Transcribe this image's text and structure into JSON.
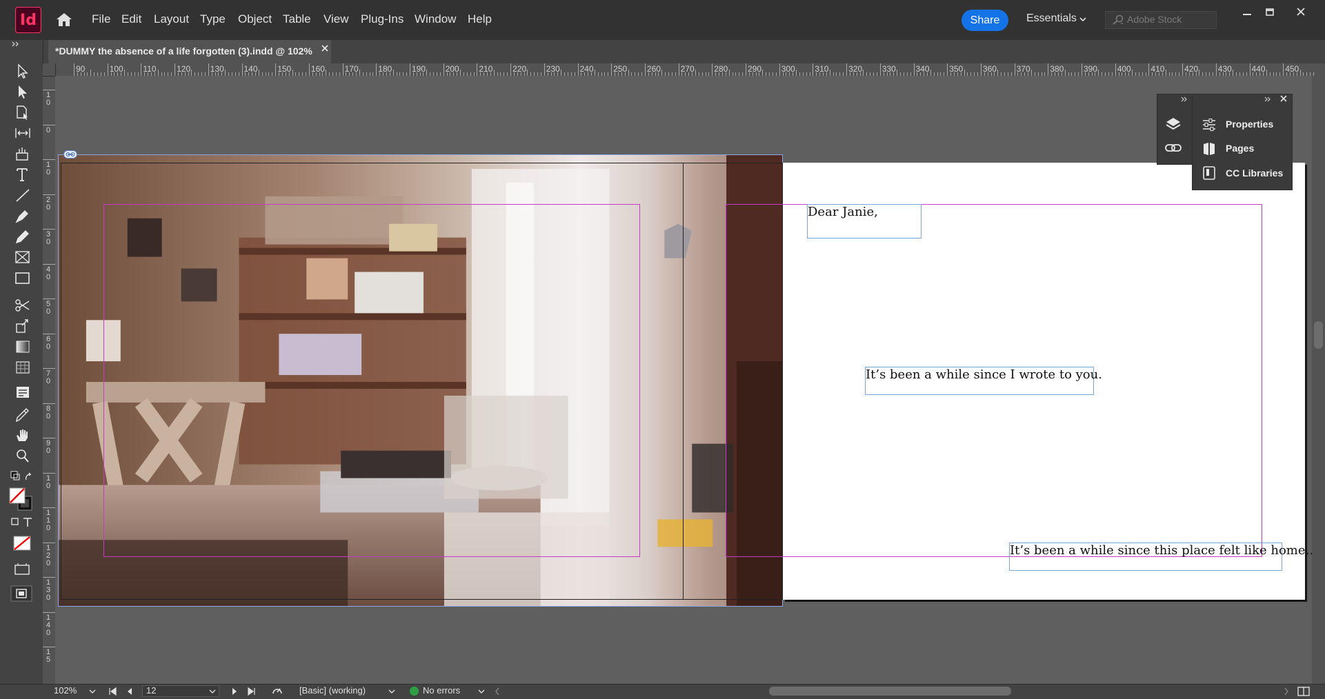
{
  "app": {
    "logo_text": "Id",
    "menu": [
      "File",
      "Edit",
      "Layout",
      "Type",
      "Object",
      "Table",
      "View",
      "Plug-Ins",
      "Window",
      "Help"
    ],
    "share_label": "Share",
    "workspace_label": "Essentials",
    "stock_search_placeholder": "Adobe Stock"
  },
  "document": {
    "tab_title": "*DUMMY the absence of a life forgotten (3).indd @ 102%"
  },
  "ruler": {
    "horizontal": [
      "90",
      "100",
      "110",
      "120",
      "130",
      "140",
      "150",
      "160",
      "170",
      "180",
      "190",
      "200",
      "210",
      "220",
      "230",
      "240",
      "250",
      "260",
      "270",
      "280",
      "290",
      "300",
      "310",
      "320",
      "330",
      "340",
      "350",
      "360",
      "370",
      "380",
      "390",
      "400",
      "410",
      "420",
      "430",
      "440",
      "450"
    ],
    "vertical": [
      "1\n0",
      "0",
      "1\n0",
      "2\n0",
      "3\n0",
      "4\n0",
      "5\n0",
      "6\n0",
      "7\n0",
      "8\n0",
      "9\n0",
      "1\n0",
      "1\n1\n0",
      "1\n2\n0",
      "1\n3\n0",
      "1\n4\n0",
      "1\n5"
    ]
  },
  "page": {
    "text_frames": [
      {
        "text": "Dear Janie,"
      },
      {
        "text": "It’s been a while since I wrote to you."
      },
      {
        "text": "It’s been a while since this place felt like home…"
      }
    ]
  },
  "panels": {
    "items": [
      {
        "label": "Properties",
        "icon": "sliders-icon"
      },
      {
        "label": "Pages",
        "icon": "pages-icon"
      },
      {
        "label": "CC Libraries",
        "icon": "libraries-icon"
      }
    ],
    "side_icons": [
      "layers-icon",
      "links-icon"
    ]
  },
  "status": {
    "zoom": "102%",
    "page_number": "12",
    "preflight_profile": "[Basic] (working)",
    "errors": "No errors",
    "error_color": "#2ea043"
  },
  "colors": {
    "accent": "#1473e6",
    "brand": "#ff3366",
    "margin_guide": "#c33bc7",
    "frame_edge": "#79a6d8"
  }
}
